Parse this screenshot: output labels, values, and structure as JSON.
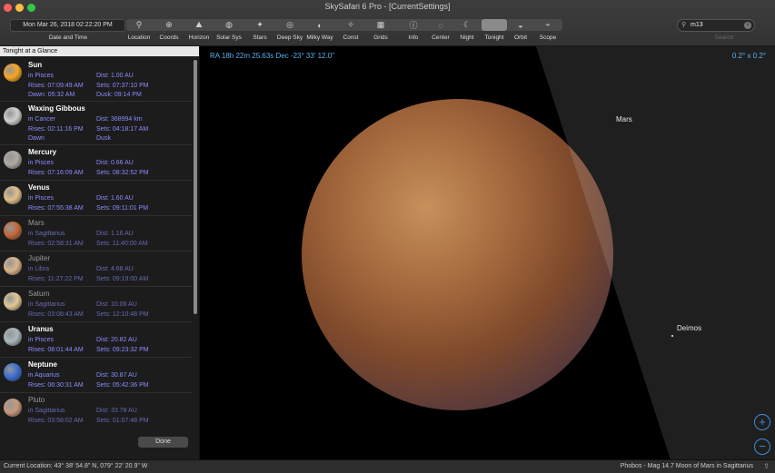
{
  "window": {
    "title": "SkySafari 6 Pro - [CurrentSettings]"
  },
  "toolbar": {
    "datetime_value": "Mon Mar 26, 2018  02:22:20 PM",
    "datetime_label": "Date and Time",
    "items": [
      {
        "label": "Location",
        "icon": "location-pin-icon",
        "glyph": "⚲"
      },
      {
        "label": "Coords",
        "icon": "coords-globe-icon",
        "glyph": "⊕"
      },
      {
        "label": "Horizon",
        "icon": "horizon-icon",
        "glyph": "⛰"
      },
      {
        "label": "Solar Sys",
        "icon": "solar-system-icon",
        "glyph": "◍"
      },
      {
        "label": "Stars",
        "icon": "stars-icon",
        "glyph": "✦"
      },
      {
        "label": "Deep Sky",
        "icon": "galaxy-icon",
        "glyph": "◎"
      },
      {
        "label": "Milky Way",
        "icon": "milky-way-icon",
        "glyph": "◐"
      },
      {
        "label": "Const",
        "icon": "constellation-icon",
        "glyph": "✧"
      },
      {
        "label": "Grids",
        "icon": "grid-icon",
        "glyph": "▦"
      },
      {
        "label": "Info",
        "icon": "info-icon",
        "glyph": "ⓘ"
      },
      {
        "label": "Center",
        "icon": "center-icon",
        "glyph": "◌"
      },
      {
        "label": "Night",
        "icon": "night-moon-icon",
        "glyph": "☾"
      },
      {
        "label": "Tonight",
        "icon": "tonight-icon",
        "glyph": ""
      },
      {
        "label": "Orbit",
        "icon": "orbit-icon",
        "glyph": "◒"
      },
      {
        "label": "Scope",
        "icon": "telescope-icon",
        "glyph": "⌁"
      }
    ],
    "search_value": "m13",
    "search_label": "Search"
  },
  "sidebar": {
    "header": "Tonight at a Glance",
    "done_label": "Done",
    "objects": [
      {
        "name": "Sun",
        "in": "in Pisces",
        "dist": "Dist: 1.00 AU",
        "rises": "Rises: 07:09:49 AM",
        "sets": "Sets: 07:37:10 PM",
        "dawn": "Dawn: 05:32 AM",
        "dusk": "Dusk: 09:14 PM",
        "color": "#f5a623",
        "dim": false
      },
      {
        "name": "Waxing Gibbous",
        "in": "in Cancer",
        "dist": "Dist: 368994 km",
        "rises": "Rises: 02:11:16 PM",
        "sets": "Sets: 04:18:17 AM",
        "dawn": "Dawn",
        "dusk": "Dusk",
        "color": "#cfcfcf",
        "dim": false
      },
      {
        "name": "Mercury",
        "in": "in Pisces",
        "dist": "Dist: 0.66 AU",
        "rises": "Rises: 07:16:09 AM",
        "sets": "Sets: 08:32:52 PM",
        "color": "#b0aba3",
        "dim": false
      },
      {
        "name": "Venus",
        "in": "in Pisces",
        "dist": "Dist: 1.60 AU",
        "rises": "Rises: 07:55:38 AM",
        "sets": "Sets: 09:11:01 PM",
        "color": "#e0c08a",
        "dim": false
      },
      {
        "name": "Mars",
        "in": "in Sagittarius",
        "dist": "Dist: 1.16 AU",
        "rises": "Rises: 02:58:31 AM",
        "sets": "Sets: 11:40:00 AM",
        "color": "#c4683a",
        "dim": true
      },
      {
        "name": "Jupiter",
        "in": "in Libra",
        "dist": "Dist: 4.68 AU",
        "rises": "Rises: 11:27:22 PM",
        "sets": "Sets: 09:19:00 AM",
        "color": "#d9b48a",
        "dim": true
      },
      {
        "name": "Saturn",
        "in": "in Sagittarius",
        "dist": "Dist: 10.06 AU",
        "rises": "Rises: 03:08:43 AM",
        "sets": "Sets: 12:10:48 PM",
        "color": "#e1c995",
        "dim": true
      },
      {
        "name": "Uranus",
        "in": "in Pisces",
        "dist": "Dist: 20.82 AU",
        "rises": "Rises: 08:01:44 AM",
        "sets": "Sets: 09:23:32 PM",
        "color": "#a8b8bc",
        "dim": false
      },
      {
        "name": "Neptune",
        "in": "in Aquarius",
        "dist": "Dist: 30.87 AU",
        "rises": "Rises: 06:30:31 AM",
        "sets": "Sets: 05:42:36 PM",
        "color": "#3d6fd1",
        "dim": false
      },
      {
        "name": "Pluto",
        "in": "in Sagittarius",
        "dist": "Dist: 33.78 AU",
        "rises": "Rises: 03:58:02 AM",
        "sets": "Sets: 01:07:48 PM",
        "color": "#c79a7e",
        "dim": true
      }
    ]
  },
  "sky": {
    "coords": "RA 18h 22m 25.63s Dec -23° 33' 12.0\"",
    "fov": "0.2° x  0.2°",
    "mars_label": "Mars",
    "deimos_label": "Deimos"
  },
  "status": {
    "location": "Current Location: 43° 38' 54.8\" N, 079° 22' 20.9\" W",
    "selected": "Phobos - Mag 14.7 Moon of Mars in Sagittarius"
  },
  "colors": {
    "accent": "#5ab0f0",
    "list_text": "#8c8cff"
  }
}
